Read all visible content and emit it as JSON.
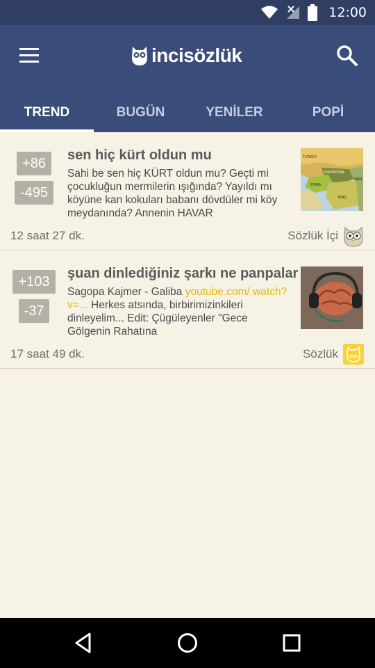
{
  "status_bar": {
    "time": "12:00"
  },
  "header": {
    "logo_text": "incisözlük",
    "tabs": [
      {
        "label": "TREND",
        "active": true
      },
      {
        "label": "BUGÜN",
        "active": false
      },
      {
        "label": "YENİLER",
        "active": false
      },
      {
        "label": "POPİ",
        "active": false
      }
    ]
  },
  "entries": [
    {
      "up": "+86",
      "down": "-495",
      "title": "sen hiç kürt oldun mu",
      "body": "Sahi be sen hiç KÜRT oldun mu? Geçti mi çocukluğun mermilerin ışığında? Yayıldı mı köyüne kan kokuları babanı dövdüler mi köy meydanında? Annenin HAVAR",
      "time": "12 saat 27 dk.",
      "source": "Sözlük İçi",
      "source_icon": "owl-icon",
      "thumb_labels": [
        "TURKEY",
        "KURDISTAN",
        "SYRIA",
        "IRAN",
        "IRAQ"
      ]
    },
    {
      "up": "+103",
      "down": "-37",
      "title": "şuan dinlediğiniz şarkı ne panpalar",
      "body_prefix": "Sagopa Kajmer - Galiba ",
      "body_link": "youtube.com/ watch?v=...",
      "body_suffix": " Herkes atsında, birbirimizinkileri dinleyelim... Edit: Çügüleyenler \"Gece Gölgenin Rahatına",
      "time": "17 saat 49 dk.",
      "source": "Sözlük",
      "source_icon": "inci-badge-icon",
      "badge_text": "inci"
    }
  ],
  "colors": {
    "app_bar": "#3a4c79",
    "status_bar": "#2f3e62",
    "background": "#f6f2e6",
    "vote_bg": "#b3b0a6",
    "link": "#e6b800"
  }
}
